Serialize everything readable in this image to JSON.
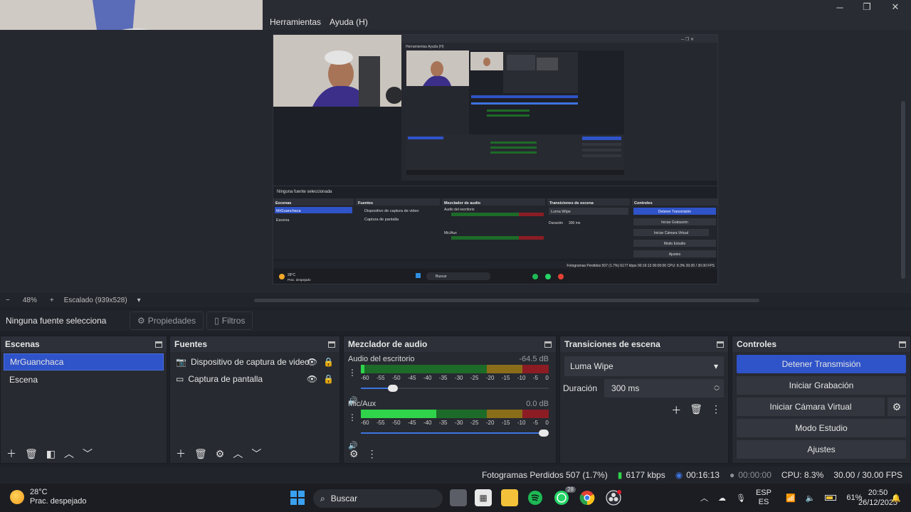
{
  "titlebar": {
    "minimize": "─",
    "maximize": "❐",
    "close": "✕"
  },
  "menu": [
    "Herramientas",
    "Ayuda (H)"
  ],
  "zoom": {
    "minus": "−",
    "percent": "48%",
    "plus": "+",
    "scale_label": "Escalado (939x528)",
    "dropdown": "▾"
  },
  "source_bar": {
    "no_source": "Ninguna fuente selecciona",
    "properties": "Propiedades",
    "filters": "Filtros"
  },
  "scenes": {
    "title": "Escenas",
    "items": [
      "MrGuanchaca",
      "Escena"
    ],
    "selected": 0
  },
  "sources": {
    "title": "Fuentes",
    "items": [
      {
        "label": "Dispositivo de captura de video",
        "icon": "camera-icon"
      },
      {
        "label": "Captura de pantalla",
        "icon": "monitor-icon"
      }
    ]
  },
  "mixer": {
    "title": "Mezclador de audio",
    "channels": [
      {
        "name": "Audio del escritorio",
        "db": "-64.5 dB",
        "volume": 0.15,
        "level": 0.02
      },
      {
        "name": "Mic/Aux",
        "db": "0.0 dB",
        "volume": 1.0,
        "level": 0.4
      }
    ],
    "ticks": [
      "-60",
      "-55",
      "-50",
      "-45",
      "-40",
      "-35",
      "-30",
      "-25",
      "-20",
      "-15",
      "-10",
      "-5",
      "0"
    ]
  },
  "transitions": {
    "title": "Transiciones de escena",
    "selected": "Luma Wipe",
    "duration_label": "Duración",
    "duration_value": "300 ms"
  },
  "controls": {
    "title": "Controles",
    "buttons": [
      "Detener Transmisión",
      "Iniciar Grabación",
      "Iniciar Cámara Virtual",
      "Modo Estudio",
      "Ajustes"
    ]
  },
  "status": {
    "dropped": "Fotogramas Perdidos 507 (1.7%)",
    "bitrate": "6177 kbps",
    "stream_time": "00:16:13",
    "rec_time": "00:00:00",
    "cpu": "CPU: 8.3%",
    "fps": "30.00 / 30.00 FPS"
  },
  "taskbar": {
    "temp": "28°C",
    "weather": "Prac. despejado",
    "search": "Buscar",
    "whatsapp_badge": "28",
    "lang1": "ESP",
    "lang2": "ES",
    "battery": "61%",
    "time": "20:50",
    "date": "26/12/2025"
  },
  "nested_preview": {
    "menu": [
      "Herramientas",
      "Ayuda (H)"
    ],
    "no_source": "Ninguna fuente seleccionada",
    "docks": [
      "Escenas",
      "Fuentes",
      "Mezclador de audio",
      "Transiciones de escena",
      "Controles"
    ],
    "scenes": [
      "MrGuanchaca",
      "Escena"
    ],
    "sources": [
      "Dispositivo de captura de video",
      "Captura de pantalla"
    ],
    "channels": [
      "Audio del escritorio",
      "Mic/Aux"
    ],
    "transition": "Luma Wipe",
    "duration_label": "Duración",
    "duration_value": "300 ms",
    "controls": [
      "Detener Transmisión",
      "Iniciar Grabación",
      "Iniciar Cámara Virtual",
      "Modo Estudio",
      "Ajustes"
    ],
    "status": "Fotogramas Perdidos 507 (1.7%)   6177 kbps   00:16:13   00:00:00   CPU: 8.3%   30.00 / 30.00 FPS",
    "search": "Buscar",
    "temp": "28°C",
    "weather": "Prac. despejado"
  },
  "colors": {
    "accent": "#2f53c8",
    "panel": "#272a31",
    "background": "#1f2128"
  }
}
